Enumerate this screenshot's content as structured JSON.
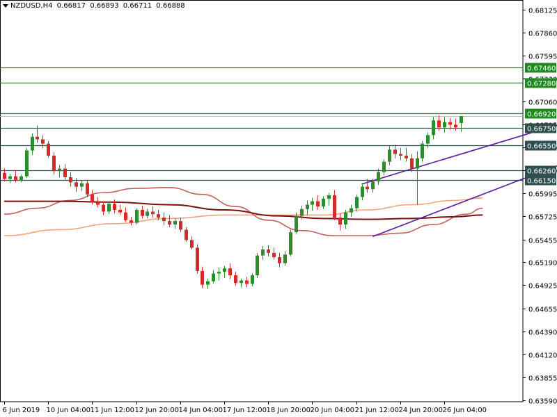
{
  "header": {
    "symbol": "NZDUSD,H4",
    "open": "0.66817",
    "high": "0.66893",
    "low": "0.66711",
    "close": "0.66888"
  },
  "colors": {
    "bull": "#2e8b2e",
    "bear": "#d42a2a",
    "level_green": "#1f8a1f",
    "level_dark": "#2f4f4f",
    "channel": "#5b1aa0",
    "ma_fast": "#c0605a",
    "ma_mid": "#f4a27a",
    "ma_slow": "#7a1010",
    "price_line": "#bfbfbf"
  },
  "chart_data": {
    "type": "candlestick",
    "ylim": [
      0.6357,
      0.6824
    ],
    "y_ticks": [
      "0.68125",
      "0.67860",
      "0.67595",
      "0.67330",
      "0.67060",
      "0.66795",
      "0.66530",
      "0.66260",
      "0.65995",
      "0.65725",
      "0.65455",
      "0.65190",
      "0.64925",
      "0.64655",
      "0.64390",
      "0.64120",
      "0.63855",
      "0.63590"
    ],
    "x_ticks": [
      "6 Jun 2019",
      "10 Jun 04:00",
      "11 Jun 12:00",
      "12 Jun 20:00",
      "14 Jun 04:00",
      "17 Jun 12:00",
      "18 Jun 20:00",
      "20 Jun 04:00",
      "21 Jun 12:00",
      "24 Jun 20:00",
      "26 Jun 04:00"
    ],
    "levels": [
      {
        "label": "0.67460",
        "value": 0.6746,
        "color": "green"
      },
      {
        "label": "0.67280",
        "value": 0.6728,
        "color": "green"
      },
      {
        "label": "0.66920",
        "value": 0.6692,
        "color": "green"
      },
      {
        "label": "0.66750",
        "value": 0.6675,
        "color": "dark"
      },
      {
        "label": "0.66550",
        "value": 0.6655,
        "color": "dark"
      },
      {
        "label": "0.66260",
        "value": 0.6626,
        "color": "dark"
      },
      {
        "label": "0.66150",
        "value": 0.6615,
        "color": "dark"
      }
    ],
    "current_price": 0.66888,
    "channel": {
      "upper": [
        [
          65,
          0.661
        ],
        [
          110,
          0.6697
        ]
      ],
      "lower": [
        [
          67,
          0.6549
        ],
        [
          122,
          0.6684
        ]
      ]
    },
    "candles": [
      [
        0.6623,
        0.6628,
        0.6613,
        0.6616
      ],
      [
        0.6616,
        0.6622,
        0.6611,
        0.6619
      ],
      [
        0.6619,
        0.6626,
        0.6612,
        0.6614
      ],
      [
        0.6614,
        0.6621,
        0.6612,
        0.6619
      ],
      [
        0.6619,
        0.6652,
        0.6617,
        0.6649
      ],
      [
        0.6649,
        0.6669,
        0.6644,
        0.6665
      ],
      [
        0.6665,
        0.6678,
        0.6658,
        0.6662
      ],
      [
        0.6662,
        0.6667,
        0.6652,
        0.6657
      ],
      [
        0.6657,
        0.666,
        0.6641,
        0.6643
      ],
      [
        0.6643,
        0.6647,
        0.6621,
        0.6625
      ],
      [
        0.6625,
        0.6632,
        0.6618,
        0.6628
      ],
      [
        0.6628,
        0.6633,
        0.6615,
        0.6618
      ],
      [
        0.6618,
        0.6624,
        0.6607,
        0.6612
      ],
      [
        0.6612,
        0.6617,
        0.6601,
        0.6607
      ],
      [
        0.6607,
        0.6614,
        0.6602,
        0.6611
      ],
      [
        0.6611,
        0.6615,
        0.6595,
        0.6598
      ],
      [
        0.6598,
        0.6603,
        0.6586,
        0.6589
      ],
      [
        0.6589,
        0.6595,
        0.6583,
        0.6586
      ],
      [
        0.6586,
        0.659,
        0.6574,
        0.6578
      ],
      [
        0.6578,
        0.659,
        0.6575,
        0.6587
      ],
      [
        0.6587,
        0.6592,
        0.6576,
        0.658
      ],
      [
        0.658,
        0.6586,
        0.6574,
        0.6577
      ],
      [
        0.6577,
        0.6583,
        0.6566,
        0.6568
      ],
      [
        0.6568,
        0.6572,
        0.6562,
        0.6565
      ],
      [
        0.6565,
        0.6582,
        0.6563,
        0.658
      ],
      [
        0.658,
        0.6585,
        0.657,
        0.6573
      ],
      [
        0.6573,
        0.6581,
        0.657,
        0.6578
      ],
      [
        0.6578,
        0.6584,
        0.6571,
        0.6575
      ],
      [
        0.6575,
        0.658,
        0.6568,
        0.6571
      ],
      [
        0.6571,
        0.6577,
        0.6562,
        0.6567
      ],
      [
        0.6567,
        0.6574,
        0.656,
        0.6563
      ],
      [
        0.6563,
        0.657,
        0.6558,
        0.6567
      ],
      [
        0.6567,
        0.6571,
        0.6554,
        0.6557
      ],
      [
        0.6557,
        0.656,
        0.6543,
        0.6545
      ],
      [
        0.6545,
        0.6549,
        0.6534,
        0.6536
      ],
      [
        0.6536,
        0.654,
        0.6506,
        0.6509
      ],
      [
        0.6509,
        0.6514,
        0.6489,
        0.6493
      ],
      [
        0.6493,
        0.65,
        0.6488,
        0.6497
      ],
      [
        0.6497,
        0.651,
        0.6494,
        0.6506
      ],
      [
        0.6506,
        0.6513,
        0.6498,
        0.6508
      ],
      [
        0.6508,
        0.6515,
        0.6501,
        0.6512
      ],
      [
        0.6512,
        0.6518,
        0.65,
        0.6504
      ],
      [
        0.6504,
        0.6508,
        0.6492,
        0.6495
      ],
      [
        0.6495,
        0.65,
        0.649,
        0.6498
      ],
      [
        0.6498,
        0.6502,
        0.649,
        0.6494
      ],
      [
        0.6494,
        0.6506,
        0.6491,
        0.6504
      ],
      [
        0.6504,
        0.653,
        0.6501,
        0.6527
      ],
      [
        0.6527,
        0.6538,
        0.6522,
        0.6534
      ],
      [
        0.6534,
        0.6539,
        0.6526,
        0.653
      ],
      [
        0.653,
        0.6536,
        0.6522,
        0.6525
      ],
      [
        0.6525,
        0.653,
        0.6513,
        0.6518
      ],
      [
        0.6518,
        0.6532,
        0.6515,
        0.6528
      ],
      [
        0.6528,
        0.6557,
        0.6526,
        0.6554
      ],
      [
        0.6554,
        0.6577,
        0.6552,
        0.6573
      ],
      [
        0.6573,
        0.6585,
        0.6569,
        0.6581
      ],
      [
        0.6581,
        0.6591,
        0.6574,
        0.6586
      ],
      [
        0.6586,
        0.6594,
        0.6579,
        0.659
      ],
      [
        0.659,
        0.6597,
        0.658,
        0.6584
      ],
      [
        0.6584,
        0.6596,
        0.6581,
        0.6593
      ],
      [
        0.6593,
        0.66,
        0.6585,
        0.6597
      ],
      [
        0.6597,
        0.6603,
        0.6568,
        0.6571
      ],
      [
        0.6571,
        0.6576,
        0.6556,
        0.6563
      ],
      [
        0.6563,
        0.658,
        0.6558,
        0.6577
      ],
      [
        0.6577,
        0.6586,
        0.6572,
        0.6582
      ],
      [
        0.6582,
        0.6598,
        0.6578,
        0.6595
      ],
      [
        0.6595,
        0.6611,
        0.6591,
        0.6607
      ],
      [
        0.6607,
        0.6616,
        0.66,
        0.6604
      ],
      [
        0.6604,
        0.6616,
        0.66,
        0.6613
      ],
      [
        0.6613,
        0.6628,
        0.6609,
        0.6624
      ],
      [
        0.6624,
        0.6639,
        0.662,
        0.6636
      ],
      [
        0.6636,
        0.6654,
        0.6632,
        0.665
      ],
      [
        0.665,
        0.6656,
        0.664,
        0.6645
      ],
      [
        0.6645,
        0.6652,
        0.6638,
        0.6643
      ],
      [
        0.6643,
        0.6652,
        0.6636,
        0.664
      ],
      [
        0.664,
        0.6645,
        0.6624,
        0.6628
      ],
      [
        0.6628,
        0.6648,
        0.6586,
        0.664
      ],
      [
        0.664,
        0.666,
        0.6636,
        0.6657
      ],
      [
        0.6657,
        0.667,
        0.6652,
        0.6667
      ],
      [
        0.6667,
        0.6688,
        0.6662,
        0.6684
      ],
      [
        0.6684,
        0.669,
        0.6672,
        0.6676
      ],
      [
        0.6676,
        0.6688,
        0.667,
        0.6682
      ],
      [
        0.6682,
        0.6687,
        0.6673,
        0.6679
      ],
      [
        0.6679,
        0.6686,
        0.6672,
        0.6676
      ],
      [
        0.6681,
        0.6689,
        0.6671,
        0.6689
      ]
    ],
    "ma_fast": [
      [
        0,
        0.6575
      ],
      [
        6,
        0.6582
      ],
      [
        12,
        0.6591
      ],
      [
        18,
        0.66
      ],
      [
        24,
        0.6605
      ],
      [
        30,
        0.6606
      ],
      [
        36,
        0.6598
      ],
      [
        42,
        0.6584
      ],
      [
        48,
        0.6568
      ],
      [
        54,
        0.6556
      ],
      [
        60,
        0.655
      ],
      [
        66,
        0.655
      ],
      [
        72,
        0.6553
      ],
      [
        78,
        0.6563
      ],
      [
        84,
        0.6575
      ],
      [
        87,
        0.6582
      ]
    ],
    "ma_mid": [
      [
        0,
        0.655
      ],
      [
        10,
        0.6557
      ],
      [
        20,
        0.6564
      ],
      [
        30,
        0.657
      ],
      [
        40,
        0.6574
      ],
      [
        50,
        0.6574
      ],
      [
        58,
        0.6574
      ],
      [
        66,
        0.658
      ],
      [
        74,
        0.6586
      ],
      [
        82,
        0.6591
      ],
      [
        87,
        0.6594
      ]
    ],
    "ma_slow": [
      [
        0,
        0.659
      ],
      [
        10,
        0.659
      ],
      [
        20,
        0.6589
      ],
      [
        30,
        0.6586
      ],
      [
        40,
        0.658
      ],
      [
        50,
        0.6573
      ],
      [
        58,
        0.657
      ],
      [
        66,
        0.6569
      ],
      [
        74,
        0.657
      ],
      [
        82,
        0.6572
      ],
      [
        87,
        0.6574
      ]
    ]
  }
}
